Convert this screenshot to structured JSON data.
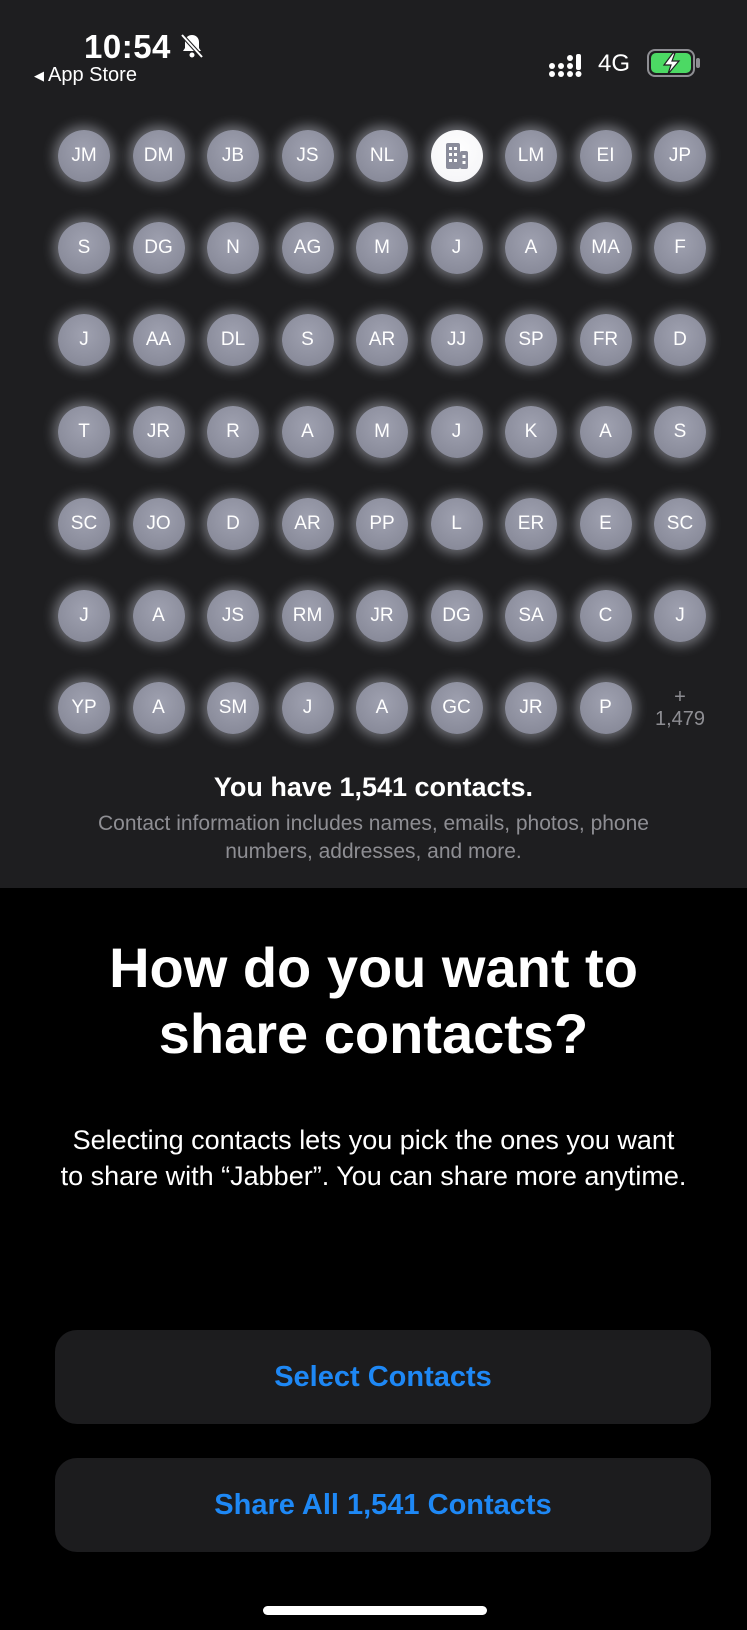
{
  "status_bar": {
    "time": "10:54",
    "back_label": "App Store",
    "network": "4G"
  },
  "contacts_preview": {
    "avatars": [
      "JM",
      "DM",
      "JB",
      "JS",
      "NL",
      "",
      "LM",
      "EI",
      "JP",
      "S",
      "DG",
      "N",
      "AG",
      "M",
      "J",
      "A",
      "MA",
      "F",
      "J",
      "AA",
      "DL",
      "S",
      "AR",
      "JJ",
      "SP",
      "FR",
      "D",
      "T",
      "JR",
      "R",
      "A",
      "M",
      "J",
      "K",
      "A",
      "S",
      "SC",
      "JO",
      "D",
      "AR",
      "PP",
      "L",
      "ER",
      "E",
      "SC",
      "J",
      "A",
      "JS",
      "RM",
      "JR",
      "DG",
      "SA",
      "C",
      "J",
      "YP",
      "A",
      "SM",
      "J",
      "A",
      "GC",
      "JR",
      "P"
    ],
    "more_plus": "+",
    "more_count": "1,479",
    "count_text": "You have 1,541 contacts.",
    "description": "Contact information includes names, emails, photos, phone numbers, addresses, and more."
  },
  "prompt": {
    "headline": "How do you want to share contacts?",
    "body": "Selecting contacts lets you pick the ones you want to share with “Jabber”. You can share more anytime."
  },
  "actions": {
    "select_label": "Select Contacts",
    "share_all_label": "Share All 1,541 Contacts"
  },
  "colors": {
    "accent": "#1e88f5",
    "panel": "#1e1e20",
    "button_bg": "#1c1c1e",
    "avatar": "#8a8c9b",
    "battery": "#4cd964"
  }
}
